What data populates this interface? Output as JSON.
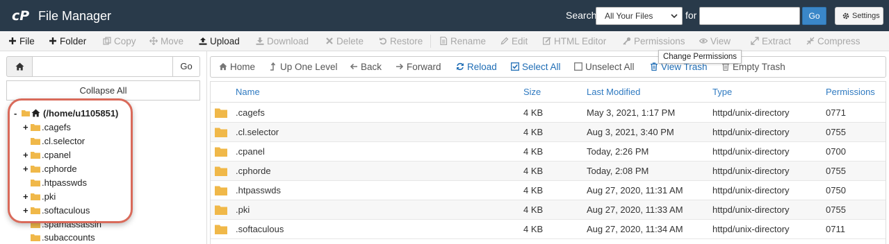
{
  "header": {
    "title": "File Manager",
    "search_label": "Search",
    "search_scope": "All Your Files",
    "for_label": "for",
    "search_value": "",
    "go_label": "Go",
    "settings_label": "Settings"
  },
  "toolbar": {
    "items": [
      {
        "label": "File",
        "icon": "plus-icon",
        "enabled": true
      },
      {
        "label": "Folder",
        "icon": "plus-icon",
        "enabled": true
      },
      {
        "label": "Copy",
        "icon": "copy-icon",
        "enabled": false
      },
      {
        "label": "Move",
        "icon": "move-icon",
        "enabled": false
      },
      {
        "label": "Upload",
        "icon": "upload-icon",
        "enabled": true
      },
      {
        "label": "Download",
        "icon": "download-icon",
        "enabled": false
      },
      {
        "label": "Delete",
        "icon": "delete-icon",
        "enabled": false
      },
      {
        "label": "Restore",
        "icon": "restore-icon",
        "enabled": false
      },
      {
        "label": "Rename",
        "icon": "rename-icon",
        "enabled": false
      },
      {
        "label": "Edit",
        "icon": "edit-icon",
        "enabled": false
      },
      {
        "label": "HTML Editor",
        "icon": "html-editor-icon",
        "enabled": false
      },
      {
        "label": "Permissions",
        "icon": "key-icon",
        "enabled": false
      },
      {
        "label": "View",
        "icon": "eye-icon",
        "enabled": false
      },
      {
        "label": "Extract",
        "icon": "extract-icon",
        "enabled": false
      },
      {
        "label": "Compress",
        "icon": "compress-icon",
        "enabled": false
      }
    ],
    "tooltip": "Change Permissions"
  },
  "sidebar": {
    "path_value": "",
    "go_label": "Go",
    "collapse_label": "Collapse All",
    "tree": [
      {
        "label": "(/home/u1105851)",
        "toggle": "-",
        "root": true
      },
      {
        "label": ".cagefs",
        "toggle": "+"
      },
      {
        "label": ".cl.selector",
        "toggle": ""
      },
      {
        "label": ".cpanel",
        "toggle": "+"
      },
      {
        "label": ".cphorde",
        "toggle": "+"
      },
      {
        "label": ".htpasswds",
        "toggle": ""
      },
      {
        "label": ".pki",
        "toggle": "+"
      },
      {
        "label": ".softaculous",
        "toggle": "+"
      },
      {
        "label": ".spamassassin",
        "toggle": ""
      },
      {
        "label": ".subaccounts",
        "toggle": ""
      }
    ]
  },
  "actionbar": {
    "items": [
      {
        "label": "Home",
        "icon": "home-icon"
      },
      {
        "label": "Up One Level",
        "icon": "level-up-icon"
      },
      {
        "label": "Back",
        "icon": "arrow-left-icon"
      },
      {
        "label": "Forward",
        "icon": "arrow-right-icon"
      },
      {
        "label": "Reload",
        "icon": "reload-icon"
      },
      {
        "label": "Select All",
        "icon": "checked-box-icon"
      },
      {
        "label": "Unselect All",
        "icon": "empty-box-icon"
      },
      {
        "label": "View Trash",
        "icon": "trash-icon"
      },
      {
        "label": "Empty Trash",
        "icon": "trash-icon"
      }
    ]
  },
  "table": {
    "columns": [
      "Name",
      "Size",
      "Last Modified",
      "Type",
      "Permissions"
    ],
    "rows": [
      {
        "name": ".cagefs",
        "size": "4 KB",
        "modified": "May 3, 2021, 1:17 PM",
        "type": "httpd/unix-directory",
        "perms": "0771"
      },
      {
        "name": ".cl.selector",
        "size": "4 KB",
        "modified": "Aug 3, 2021, 3:40 PM",
        "type": "httpd/unix-directory",
        "perms": "0755"
      },
      {
        "name": ".cpanel",
        "size": "4 KB",
        "modified": "Today, 2:26 PM",
        "type": "httpd/unix-directory",
        "perms": "0700"
      },
      {
        "name": ".cphorde",
        "size": "4 KB",
        "modified": "Today, 2:08 PM",
        "type": "httpd/unix-directory",
        "perms": "0755"
      },
      {
        "name": ".htpasswds",
        "size": "4 KB",
        "modified": "Aug 27, 2020, 11:31 AM",
        "type": "httpd/unix-directory",
        "perms": "0750"
      },
      {
        "name": ".pki",
        "size": "4 KB",
        "modified": "Aug 27, 2020, 11:33 AM",
        "type": "httpd/unix-directory",
        "perms": "0755"
      },
      {
        "name": ".softaculous",
        "size": "4 KB",
        "modified": "Aug 27, 2020, 11:34 AM",
        "type": "httpd/unix-directory",
        "perms": "0711"
      }
    ]
  },
  "colors": {
    "header_bg": "#293a4a",
    "accent_blue": "#2f7ac1",
    "folder_yellow": "#f0b849",
    "highlight_red": "#d96a5a"
  }
}
